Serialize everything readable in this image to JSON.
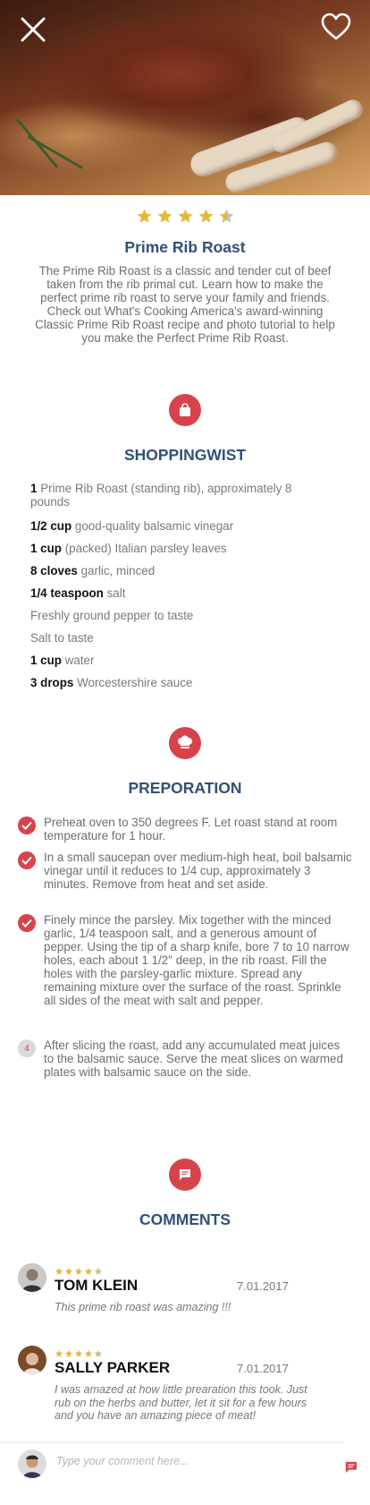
{
  "recipe": {
    "title": "Prime Rib Roast",
    "rating": 4.5,
    "description": "The Prime Rib Roast is a classic and tender cut of beef taken from the rib primal cut.  Learn how to make the perfect prime rib roast to serve your family and friends. Check out What's Cooking America's award-winning Classic Prime Rib Roast recipe and photo tutorial to help you make the Perfect Prime Rib Roast."
  },
  "hero": {
    "close_icon": "close-icon",
    "favorite_icon": "heart-icon"
  },
  "shopping": {
    "icon": "shopping-bag-icon",
    "title": "SHOPPINGWIST",
    "items": [
      {
        "qty": "1",
        "text": "Prime Rib Roast (standing rib), approximately 8 pounds"
      },
      {
        "qty": "1/2 cup",
        "text": "good-quality balsamic vinegar"
      },
      {
        "qty": "1 cup",
        "text": "(packed) Italian parsley leaves"
      },
      {
        "qty": "8 cloves",
        "text": "garlic, minced"
      },
      {
        "qty": "1/4 teaspoon",
        "text": "salt"
      },
      {
        "qty": "",
        "text": "Freshly ground pepper to taste"
      },
      {
        "qty": "",
        "text": "Salt to taste"
      },
      {
        "qty": "1 cup",
        "text": "water"
      },
      {
        "qty": "3 drops",
        "text": "Worcestershire sauce"
      }
    ]
  },
  "preparation": {
    "icon": "chef-hat-icon",
    "title": "PREPORATION",
    "steps": [
      {
        "done": true,
        "text": "Preheat oven to 350 degrees F.  Let roast stand at room temperature for 1 hour."
      },
      {
        "done": true,
        "text": "In a small saucepan over medium-high heat, boil balsamic vinegar until it reduces to 1/4 cup, approximately 3 minutes.  Remove from heat and set aside."
      },
      {
        "done": true,
        "text": "Finely mince the parsley.  Mix together with the minced garlic, 1/4 teaspoon salt, and a generous amount of pepper.  Using the tip of a sharp knife, bore 7 to 10 narrow holes, each about 1 1/2\" deep, in the rib roast.  Fill the holes with the parsley-garlic mixture.  Spread any remaining mixture over the surface of the roast.  Sprinkle all sides of the meat with salt and pepper."
      },
      {
        "done": false,
        "number": "4",
        "text": "After slicing the roast, add any accumulated meat juices to the balsamic sauce.  Serve the meat slices on warmed plates with balsamic sauce on the side."
      }
    ]
  },
  "comments": {
    "icon": "comment-icon",
    "title": "COMMENTS",
    "items": [
      {
        "name": "TOM KLEIN",
        "date": "7.01.2017",
        "rating": 4.5,
        "text": "This prime rib roast was amazing !!!"
      },
      {
        "name": "SALLY PARKER",
        "date": "7.01.2017",
        "rating": 4.5,
        "text": "I was amazed at how little prearation this took. Just rub on the herbs and butter, let it sit for a few hours and you have an amazing piece of meat!"
      }
    ],
    "input_placeholder": "Type your comment here...",
    "send_icon": "send-comment-icon"
  },
  "colors": {
    "accent": "#d8434b",
    "title": "#30507a",
    "star": "#e2b93b"
  }
}
